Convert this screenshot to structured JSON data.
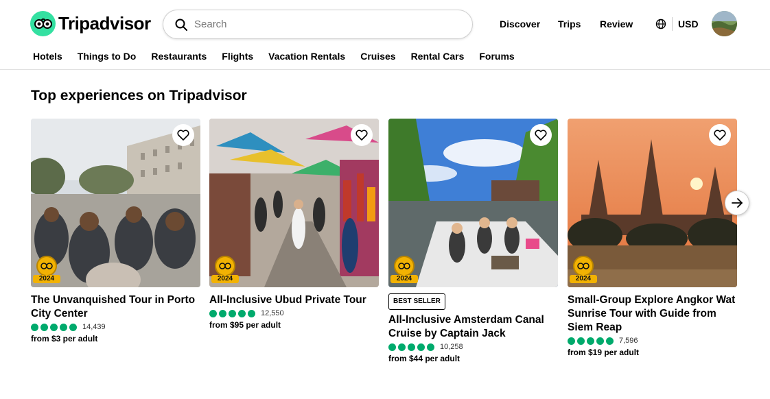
{
  "brand": {
    "name": "Tripadvisor",
    "icon": "owl-logo-icon",
    "color": "#34e0a1"
  },
  "search": {
    "placeholder": "Search"
  },
  "topnav": {
    "discover": "Discover",
    "trips": "Trips",
    "review": "Review"
  },
  "currency": "USD",
  "subnav": [
    "Hotels",
    "Things to Do",
    "Restaurants",
    "Flights",
    "Vacation Rentals",
    "Cruises",
    "Rental Cars",
    "Forums"
  ],
  "section": {
    "title": "Top experiences on Tripadvisor"
  },
  "cards": [
    {
      "title": "The Unvanquished Tour in Porto City Center",
      "badge_year": "2024",
      "rating_count": "14,439",
      "price": "from $3 per adult",
      "best_seller": ""
    },
    {
      "title": "All-Inclusive Ubud Private Tour",
      "badge_year": "2024",
      "rating_count": "12,550",
      "price": "from $95 per adult",
      "best_seller": ""
    },
    {
      "title": "All-Inclusive Amsterdam Canal Cruise by Captain Jack",
      "badge_year": "2024",
      "rating_count": "10,258",
      "price": "from $44 per adult",
      "best_seller": "BEST SELLER"
    },
    {
      "title": "Small-Group Explore Angkor Wat Sunrise Tour with Guide from Siem Reap",
      "badge_year": "2024",
      "rating_count": "7,596",
      "price": "from $19 per adult",
      "best_seller": ""
    }
  ],
  "rating_color": "#00aa6c"
}
